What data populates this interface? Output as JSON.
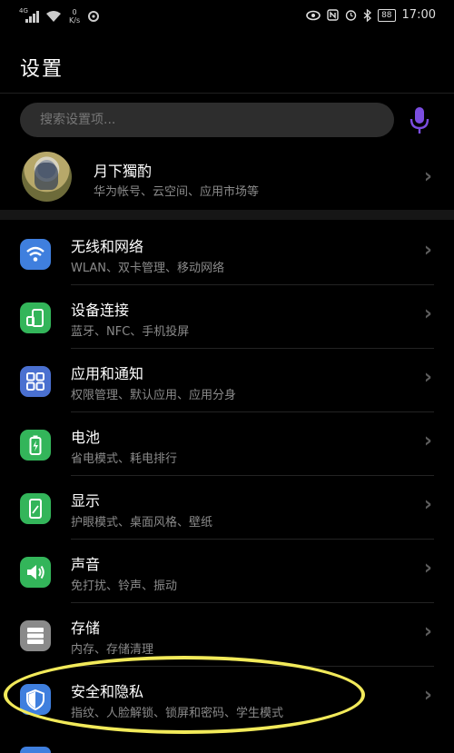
{
  "status_bar": {
    "network_type": "4G",
    "speed_value": "0",
    "speed_unit": "K/s",
    "battery": "88",
    "time": "17:00"
  },
  "page": {
    "title": "设置"
  },
  "search": {
    "placeholder": "搜索设置项..."
  },
  "account": {
    "name": "月下獨酌",
    "subtitle": "华为帐号、云空间、应用市场等"
  },
  "settings": [
    {
      "label": "无线和网络",
      "subtitle": "WLAN、双卡管理、移动网络",
      "icon": "wifi-icon",
      "color": "#3f7fde"
    },
    {
      "label": "设备连接",
      "subtitle": "蓝牙、NFC、手机投屏",
      "icon": "device-connect-icon",
      "color": "#33b55a"
    },
    {
      "label": "应用和通知",
      "subtitle": "权限管理、默认应用、应用分身",
      "icon": "apps-icon",
      "color": "#4a70d0"
    },
    {
      "label": "电池",
      "subtitle": "省电模式、耗电排行",
      "icon": "battery-icon",
      "color": "#33b55a"
    },
    {
      "label": "显示",
      "subtitle": "护眼模式、桌面风格、壁纸",
      "icon": "display-icon",
      "color": "#33b55a"
    },
    {
      "label": "声音",
      "subtitle": "免打扰、铃声、振动",
      "icon": "sound-icon",
      "color": "#33b55a"
    },
    {
      "label": "存储",
      "subtitle": "内存、存储清理",
      "icon": "storage-icon",
      "color": "#8a8a8a"
    },
    {
      "label": "安全和隐私",
      "subtitle": "指纹、人脸解锁、锁屏和密码、学生模式",
      "icon": "shield-icon",
      "color": "#3f7fde"
    }
  ],
  "colors": {
    "background": "#000000",
    "highlight": "#f2ea5a",
    "mic": "#7b4de0"
  }
}
